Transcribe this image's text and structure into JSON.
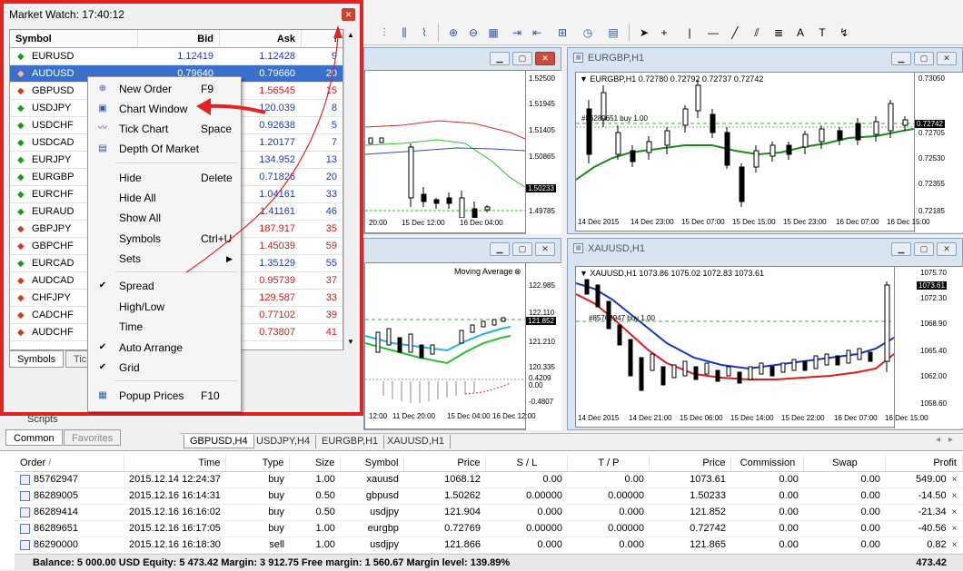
{
  "market_watch": {
    "title": "Market Watch: 17:40:12",
    "columns": {
      "symbol": "Symbol",
      "bid": "Bid",
      "ask": "Ask",
      "spread": "!"
    },
    "rows": [
      {
        "symbol": "EURUSD",
        "dir": "up",
        "bid": "1.12419",
        "ask": "1.12428",
        "spread": "9"
      },
      {
        "symbol": "AUDUSD",
        "dir": "down",
        "bid": "0.79640",
        "ask": "0.79660",
        "spread": "20"
      },
      {
        "symbol": "GBPUSD",
        "dir": "down",
        "bid": "",
        "ask": "1.56545",
        "spread": "15"
      },
      {
        "symbol": "USDJPY",
        "dir": "up",
        "bid": "",
        "ask": "120.039",
        "spread": "8"
      },
      {
        "symbol": "USDCHF",
        "dir": "up",
        "bid": "",
        "ask": "0.92638",
        "spread": "5"
      },
      {
        "symbol": "USDCAD",
        "dir": "up",
        "bid": "",
        "ask": "1.20177",
        "spread": "7"
      },
      {
        "symbol": "EURJPY",
        "dir": "up",
        "bid": "",
        "ask": "134.952",
        "spread": "13"
      },
      {
        "symbol": "EURGBP",
        "dir": "up",
        "bid": "",
        "ask": "0.71826",
        "spread": "20"
      },
      {
        "symbol": "EURCHF",
        "dir": "up",
        "bid": "",
        "ask": "1.04161",
        "spread": "33"
      },
      {
        "symbol": "EURAUD",
        "dir": "up",
        "bid": "",
        "ask": "1.41161",
        "spread": "46"
      },
      {
        "symbol": "GBPJPY",
        "dir": "down",
        "bid": "",
        "ask": "187.917",
        "spread": "35"
      },
      {
        "symbol": "GBPCHF",
        "dir": "down",
        "bid": "",
        "ask": "1.45039",
        "spread": "59"
      },
      {
        "symbol": "EURCAD",
        "dir": "up",
        "bid": "",
        "ask": "1.35129",
        "spread": "55"
      },
      {
        "symbol": "AUDCAD",
        "dir": "down",
        "bid": "",
        "ask": "0.95739",
        "spread": "37"
      },
      {
        "symbol": "CHFJPY",
        "dir": "down",
        "bid": "",
        "ask": "129.587",
        "spread": "33"
      },
      {
        "symbol": "CADCHF",
        "dir": "down",
        "bid": "",
        "ask": "0.77102",
        "spread": "39"
      },
      {
        "symbol": "AUDCHF",
        "dir": "down",
        "bid": "",
        "ask": "0.73807",
        "spread": "41"
      }
    ],
    "tabs": [
      "Symbols",
      "Tick"
    ]
  },
  "context_menu": {
    "items": [
      {
        "label": "New Order",
        "shortcut": "F9",
        "icon": "new-order-icon"
      },
      {
        "label": "Chart Window",
        "shortcut": "",
        "icon": "chart-window-icon"
      },
      {
        "label": "Tick Chart",
        "shortcut": "Space",
        "icon": "tick-chart-icon"
      },
      {
        "label": "Depth Of Market",
        "shortcut": "",
        "icon": "depth-of-market-icon"
      },
      {
        "label": "Hide",
        "shortcut": "Delete",
        "icon": ""
      },
      {
        "label": "Hide All",
        "shortcut": "",
        "icon": ""
      },
      {
        "label": "Show All",
        "shortcut": "",
        "icon": ""
      },
      {
        "label": "Symbols",
        "shortcut": "Ctrl+U",
        "icon": ""
      },
      {
        "label": "Sets",
        "shortcut": "",
        "icon": "submenu-arrow-icon"
      },
      {
        "label": "Spread",
        "shortcut": "",
        "icon": "check-icon"
      },
      {
        "label": "High/Low",
        "shortcut": "",
        "icon": ""
      },
      {
        "label": "Time",
        "shortcut": "",
        "icon": ""
      },
      {
        "label": "Auto Arrange",
        "shortcut": "",
        "icon": "check-icon"
      },
      {
        "label": "Grid",
        "shortcut": "",
        "icon": "check-icon"
      },
      {
        "label": "Popup Prices",
        "shortcut": "F10",
        "icon": "popup-prices-icon"
      }
    ]
  },
  "charts": {
    "eurgbp": {
      "title": "EURGBP,H1",
      "info": "EURGBP,H1  0.72780 0.72792 0.72737 0.72742",
      "order_label": "#86289651 buy 1.00",
      "prices": [
        "0.73050",
        "0.72742",
        "0.72705",
        "0.72530",
        "0.72355",
        "0.72185"
      ],
      "times": [
        "14 Dec 2015",
        "14 Dec 23:00",
        "15 Dec 07:00",
        "15 Dec 15:00",
        "15 Dec 23:00",
        "16 Dec 07:00",
        "16 Dec 15:00"
      ]
    },
    "xauusd": {
      "title": "XAUUSD,H1",
      "info": "XAUUSD,H1  1073.86 1075.02 1072.83 1073.61",
      "order_label": "#85762947 buy 1.00",
      "prices": [
        "1075.70",
        "1073.61",
        "1072.30",
        "1068.90",
        "1065.40",
        "1062.00",
        "1058.60"
      ],
      "times": [
        "14 Dec 2015",
        "14 Dec 21:00",
        "15 Dec 06:00",
        "15 Dec 14:00",
        "15 Dec 22:00",
        "16 Dec 07:00",
        "16 Dec 15:00"
      ]
    },
    "gbpusd": {
      "prices": [
        "1.52500",
        "1.51945",
        "1.51405",
        "1.50865",
        "1.50233",
        "1.49785"
      ],
      "times": [
        "20:00",
        "15 Dec 12:00",
        "16 Dec 04:00"
      ]
    },
    "usdjpy": {
      "indicator": "Moving Average",
      "prices": [
        "122.985",
        "122.110",
        "121.852",
        "121.210",
        "120.335",
        "0.4209",
        "0.00",
        "-0.4807"
      ],
      "times": [
        "12:00",
        "11 Dec 20:00",
        "15 Dec 04:00",
        "16 Dec 12:00"
      ]
    }
  },
  "chart_tabs": [
    "GBPUSD,H4",
    "USDJPY,H4",
    "EURGBP,H1",
    "XAUUSD,H1"
  ],
  "navigator": {
    "partial_label": "Scripts",
    "tabs": [
      "Common",
      "Favorites"
    ]
  },
  "terminal": {
    "columns": [
      "Order",
      "Time",
      "Type",
      "Size",
      "Symbol",
      "Price",
      "S / L",
      "T / P",
      "Price",
      "Commission",
      "Swap",
      "Profit"
    ],
    "rows": [
      [
        "85762947",
        "2015.12.14 12:24:37",
        "buy",
        "1.00",
        "xauusd",
        "1068.12",
        "0.00",
        "0.00",
        "1073.61",
        "0.00",
        "0.00",
        "549.00"
      ],
      [
        "86289005",
        "2015.12.16 16:14:31",
        "buy",
        "0.50",
        "gbpusd",
        "1.50262",
        "0.00000",
        "0.00000",
        "1.50233",
        "0.00",
        "0.00",
        "-14.50"
      ],
      [
        "86289414",
        "2015.12.16 16:16:02",
        "buy",
        "0.50",
        "usdjpy",
        "121.904",
        "0.000",
        "0.000",
        "121.852",
        "0.00",
        "0.00",
        "-21.34"
      ],
      [
        "86289651",
        "2015.12.16 16:17:05",
        "buy",
        "1.00",
        "eurgbp",
        "0.72769",
        "0.00000",
        "0.00000",
        "0.72742",
        "0.00",
        "0.00",
        "-40.56"
      ],
      [
        "86290000",
        "2015.12.16 16:18:30",
        "sell",
        "1.00",
        "usdjpy",
        "121.866",
        "0.000",
        "0.000",
        "121.865",
        "0.00",
        "0.00",
        "0.82"
      ]
    ],
    "balance": "Balance: 5 000.00 USD  Equity: 5 473.42  Margin: 3 912.75  Free margin: 1 560.67  Margin level: 139.89%",
    "total_profit": "473.42"
  },
  "colors": {
    "highlight": "#e52222",
    "selection": "#3a6fca",
    "up": "#1a9a1a",
    "down": "#d03a1a"
  }
}
